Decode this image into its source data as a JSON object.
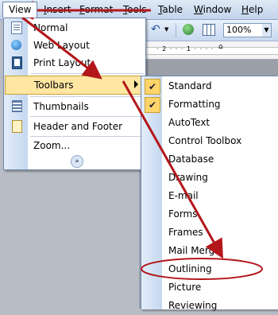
{
  "menubar": {
    "items": [
      "View",
      "Insert",
      "Format",
      "Tools",
      "Table",
      "Window",
      "Help"
    ]
  },
  "toolbar": {
    "zoom_value": "100%",
    "ruler_marks": "· 2 · · · 1 · · · ·"
  },
  "view_menu": {
    "items": [
      {
        "label": "Normal",
        "icon": "normal-view-icon"
      },
      {
        "label": "Web Layout",
        "icon": "web-layout-icon"
      },
      {
        "label": "Print Layout",
        "icon": "print-layout-icon"
      },
      {
        "label": "Toolbars",
        "icon": "",
        "submenu": true,
        "highlighted": true
      },
      {
        "label": "Thumbnails",
        "icon": "thumbnails-icon"
      },
      {
        "label": "Header and Footer",
        "icon": "header-footer-icon"
      },
      {
        "label": "Zoom...",
        "icon": ""
      }
    ],
    "expand_glyph": "»"
  },
  "toolbars_submenu": {
    "items": [
      {
        "label": "Standard",
        "checked": true
      },
      {
        "label": "Formatting",
        "checked": true
      },
      {
        "label": "AutoText",
        "checked": false
      },
      {
        "label": "Control Toolbox",
        "checked": false
      },
      {
        "label": "Database",
        "checked": false
      },
      {
        "label": "Drawing",
        "checked": false
      },
      {
        "label": "E-mail",
        "checked": false
      },
      {
        "label": "Forms",
        "checked": false
      },
      {
        "label": "Frames",
        "checked": false
      },
      {
        "label": "Mail Merge",
        "checked": false
      },
      {
        "label": "Outlining",
        "checked": false,
        "annotated": true
      },
      {
        "label": "Picture",
        "checked": false
      },
      {
        "label": "Reviewing",
        "checked": false
      }
    ],
    "check_glyph": "✔"
  },
  "colors": {
    "annotation_red": "#b3161b",
    "highlight": "#ffe7a2",
    "menubar_gradient_top": "#dfe9f6"
  }
}
